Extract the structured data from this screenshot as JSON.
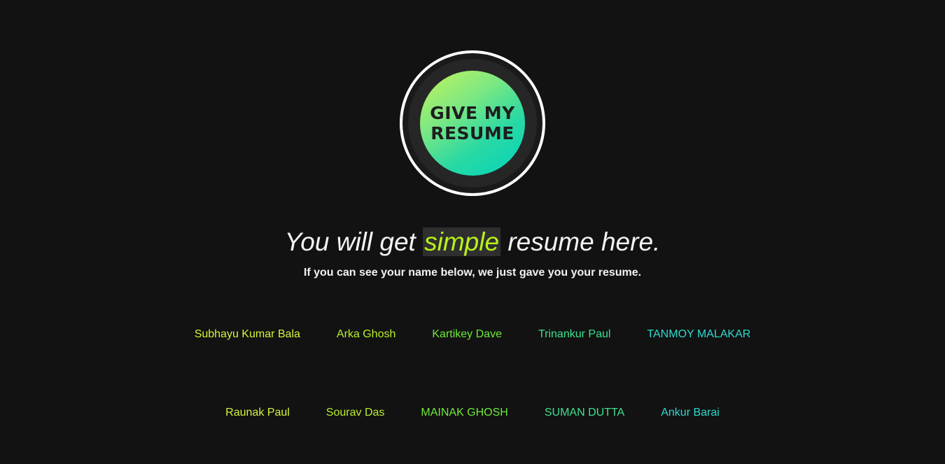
{
  "logo": {
    "line1": "GIVE MY",
    "line2": "RESUME"
  },
  "headline": {
    "before": "You will get ",
    "highlight": "simple",
    "after": " resume here."
  },
  "subline": "If you can see your name below, we just gave you your resume.",
  "names_row_1": [
    {
      "label": "Subhayu Kumar Bala",
      "color": "#d6f33a"
    },
    {
      "label": "Arka Ghosh",
      "color": "#b9f02c"
    },
    {
      "label": "Kartikey Dave",
      "color": "#6fea3a"
    },
    {
      "label": "Trinankur Paul",
      "color": "#3ee08e"
    },
    {
      "label": "TANMOY MALAKAR",
      "color": "#2ed9cf"
    }
  ],
  "names_row_2": [
    {
      "label": "Raunak Paul",
      "color": "#d6f33a"
    },
    {
      "label": "Sourav Das",
      "color": "#b9f02c"
    },
    {
      "label": "MAINAK GHOSH",
      "color": "#6fea3a"
    },
    {
      "label": "SUMAN DUTTA",
      "color": "#3ee08e"
    },
    {
      "label": "Ankur Barai",
      "color": "#2ed9cf"
    }
  ],
  "colors": {
    "background": "#121212",
    "accent": "#b8f21a"
  }
}
